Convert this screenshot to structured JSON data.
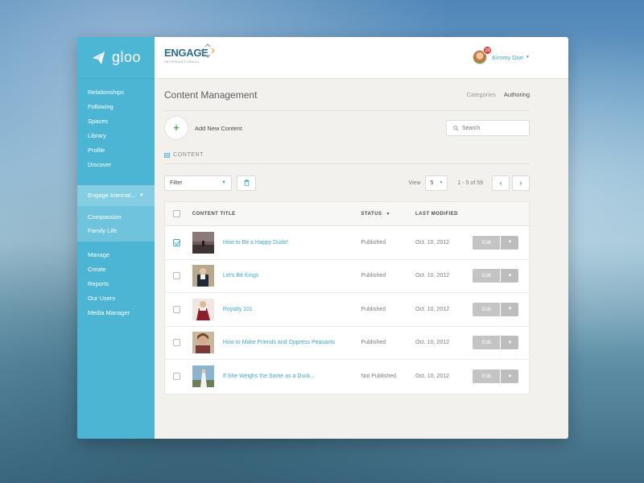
{
  "brand": {
    "logo_text": "gloo"
  },
  "sidebar": {
    "group1": [
      "Relationships",
      "Following",
      "Spaces",
      "Library",
      "Profile",
      "Discover"
    ],
    "org": {
      "label": "Engage Internat..."
    },
    "org_items": [
      "Compassion",
      "Family Life"
    ],
    "group2": [
      "Manage",
      "Create",
      "Reports",
      "Our Users",
      "Media Manager"
    ]
  },
  "topbar": {
    "org_logo_word": "ENGAGE",
    "org_logo_sub": "INTERNATIONAL",
    "user_name": "Kimmy Doe",
    "notification_count": "23"
  },
  "page": {
    "title": "Content Management",
    "tabs": [
      "Categories",
      "Authoring"
    ],
    "active_tab": "Authoring",
    "add_label": "Add New Content",
    "search_placeholder": "Search",
    "section_label": "CONTENT",
    "filter_label": "Filter",
    "view_label": "View",
    "view_value": "5",
    "pager_text": "1 - 5 of 59"
  },
  "table": {
    "headers": {
      "title": "CONTENT TITLE",
      "status": "STATUS",
      "modified": "LAST MODIFIED"
    },
    "rows": [
      {
        "title": "How to Be a Happy Dude!",
        "status": "Published",
        "modified": "Oct. 10, 2012",
        "checked": true,
        "action": "Edit"
      },
      {
        "title": "Let's Be Kings",
        "status": "Published",
        "modified": "Oct. 10, 2012",
        "checked": false,
        "action": "Edit"
      },
      {
        "title": "Royalty 101",
        "status": "Published",
        "modified": "Oct. 10, 2012",
        "checked": false,
        "action": "Edit"
      },
      {
        "title": "How to Make Friends and Oppress Peasants",
        "status": "Published",
        "modified": "Oct. 10, 2012",
        "checked": false,
        "action": "Edit"
      },
      {
        "title": "If She Weighs the Same as a Duck...",
        "status": "Not Published",
        "modified": "Oct. 10, 2012",
        "checked": false,
        "action": "Edit"
      }
    ]
  },
  "colors": {
    "sidebar": "#4bb5d3",
    "accent": "#3aa8cd",
    "add_plus": "#4caf50",
    "badge": "#e3342f"
  }
}
